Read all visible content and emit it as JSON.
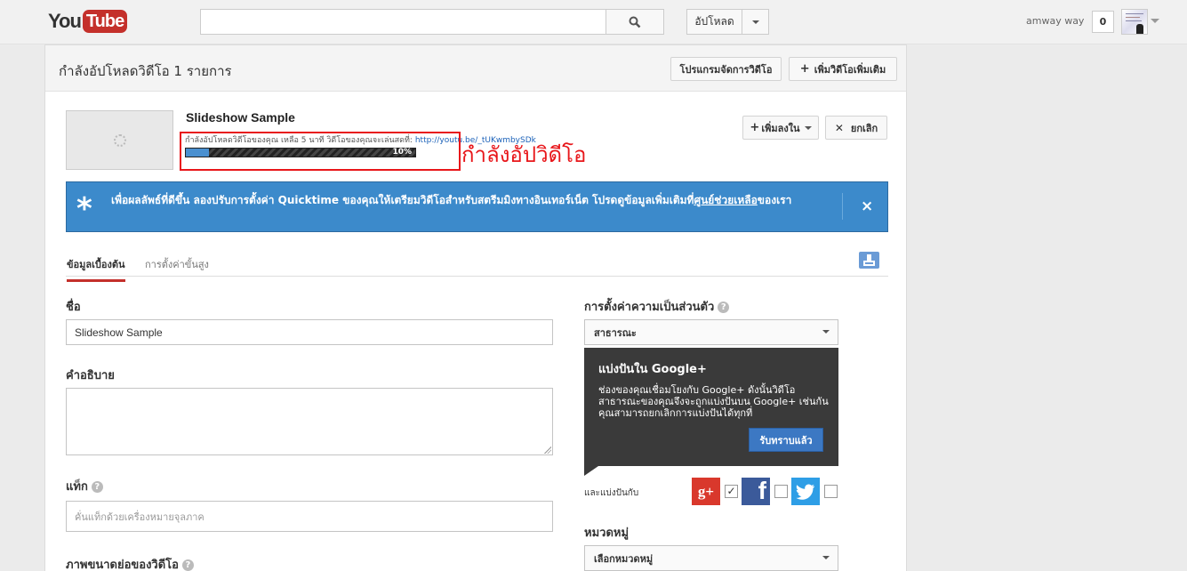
{
  "header": {
    "logo_you": "You",
    "logo_tube": "Tube",
    "search_placeholder": "",
    "upload_label": "อัปโหลด",
    "username": "amway way",
    "notification_count": "0",
    "icons": [
      "search-icon",
      "chevron-down-icon",
      "avatar"
    ]
  },
  "panel": {
    "title": "กำลังอัปโหลดวิดีโอ 1 รายการ",
    "video_manager_label": "โปรแกรมจัดการวิดีโอ",
    "add_more_label": "เพิ่มวิดีโอเพิ่มเติม"
  },
  "upload": {
    "video_title": "Slideshow Sample",
    "status_text": "กำลังอัปโหลดวิดีโอของคุณ เหลือ 5 นาที วิดีโอของคุณจะเล่นสดที่: ",
    "video_link": "http://youtu.be/_tUKwmbySDk",
    "progress": 0.1,
    "progress_label": "10%",
    "annotation": "กำลังอัปวิดีโอ",
    "add_to_label": "เพิ่มลงใน",
    "cancel_label": "ยกเลิก"
  },
  "banner": {
    "text": "เพื่อผลลัพธ์ที่ดีขึ้น ลองปรับการตั้งค่า Quicktime ของคุณให้เตรียมวิดีโอสำหรับสตรีมมิงทางอินเทอร์เน็ต โปรดดูข้อมูลเพิ่มเติมที่",
    "link_text": "ศูนย์ช่วยเหลือ",
    "suffix": "ของเรา",
    "close": "×"
  },
  "tabs": {
    "basic": "ข้อมูลเบื้องต้น",
    "advanced": "การตั้งค่าขั้นสูง"
  },
  "form": {
    "title_label": "ชื่อ",
    "title_value": "Slideshow Sample",
    "description_label": "คำอธิบาย",
    "description_value": "",
    "tags_label": "แท็ก",
    "tags_placeholder": "คั่นแท็กด้วยเครื่องหมายจุลภาค",
    "thumbnail_label": "ภาพขนาดย่อของวิดีโอ",
    "privacy_label": "การตั้งค่าความเป็นส่วนตัว",
    "privacy_value": "สาธารณะ",
    "also_share_label": "และแบ่งปันกับ",
    "category_label": "หมวดหมู่",
    "category_value": "เลือกหมวดหมู่"
  },
  "tooltip": {
    "title": "แบ่งปันใน Google+",
    "body": "ช่องของคุณเชื่อมโยงกับ Google+ ดังนั้นวิดีโอสาธารณะของคุณจึงจะถูกแบ่งปันบน Google+ เช่นกัน คุณสามารถยกเลิกการแบ่งปันได้ทุกที่",
    "button": "รับทราบแล้ว"
  },
  "social": {
    "gplus_glyph": "g+",
    "gplus_checked": true,
    "facebook_glyph": "f",
    "facebook_checked": false,
    "twitter_checked": false
  },
  "colors": {
    "brand_red": "#c4302b",
    "banner_blue": "#3c8acb",
    "progress_blue": "#4a90d0",
    "annotation_red": "#e8161a"
  }
}
